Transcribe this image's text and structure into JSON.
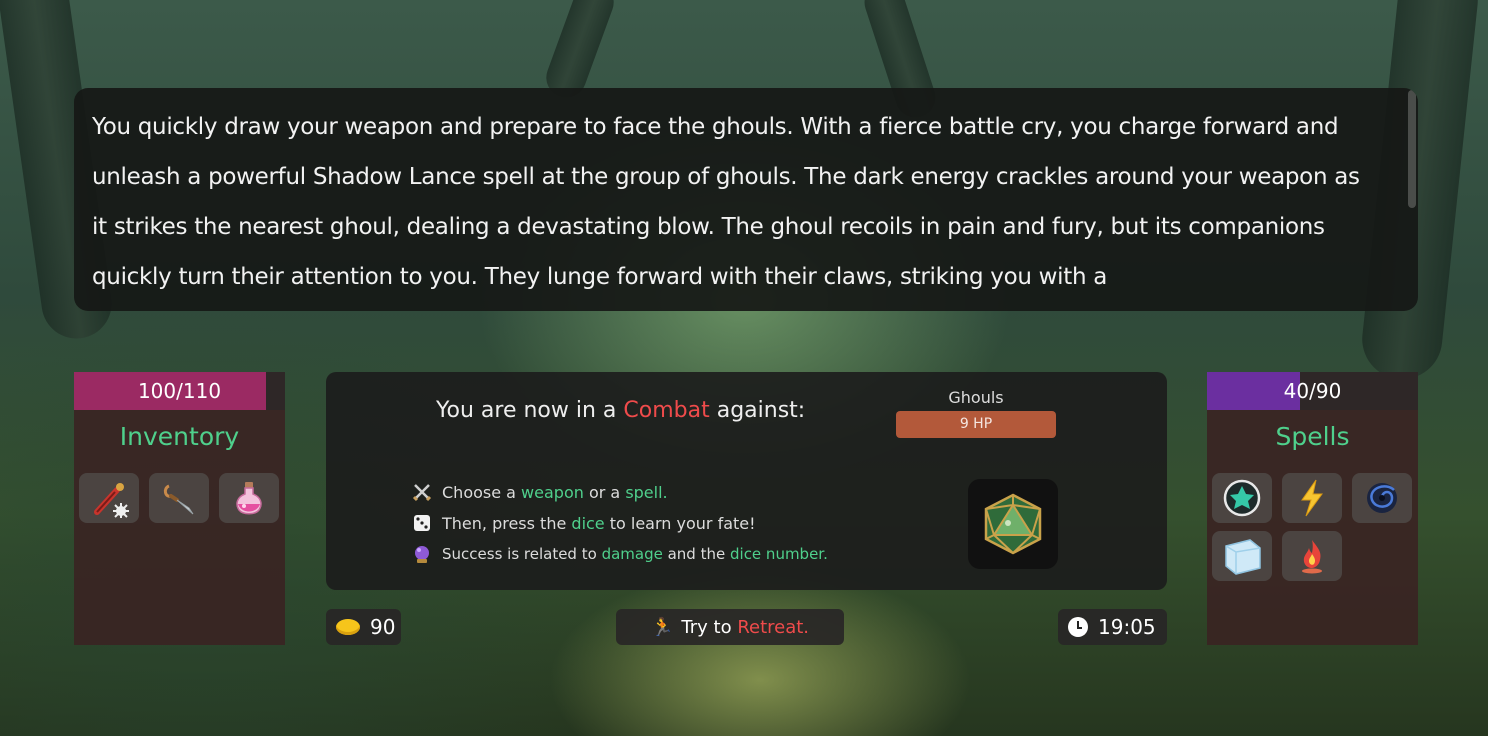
{
  "narrative": {
    "text": "You quickly draw your weapon and prepare to face the ghouls. With a fierce battle cry, you charge forward and unleash a powerful Shadow Lance spell at the group of ghouls. The dark energy crackles around your weapon as it strikes the nearest ghoul, dealing a devastating blow. The ghoul recoils in pain and fury, but its companions quickly turn their attention to you. They lunge forward with their claws, striking you with a"
  },
  "health": {
    "label": "100/110",
    "current": 100,
    "max": 110,
    "color": "#9b2a63"
  },
  "mana": {
    "label": "40/90",
    "current": 40,
    "max": 90,
    "color": "#6b2fa0"
  },
  "inventory": {
    "title": "Inventory",
    "items": [
      {
        "icon": "mace-icon"
      },
      {
        "icon": "dagger-icon"
      },
      {
        "icon": "potion-icon"
      }
    ]
  },
  "spells": {
    "title": "Spells",
    "items": [
      {
        "icon": "shadow-lance-icon"
      },
      {
        "icon": "lightning-icon"
      },
      {
        "icon": "vortex-icon"
      },
      {
        "icon": "ice-block-icon"
      },
      {
        "icon": "fire-icon"
      }
    ]
  },
  "combat": {
    "prefix": "You are now in a ",
    "keyword": "Combat",
    "suffix": " against:",
    "enemy": {
      "name": "Ghouls",
      "hp": "9 HP"
    },
    "instructions": [
      {
        "icon": "swords-icon",
        "parts": [
          "Choose a ",
          "weapon",
          " or a ",
          "spell."
        ]
      },
      {
        "icon": "dice-icon",
        "parts": [
          "Then, press the ",
          "dice",
          " to learn your fate!"
        ]
      },
      {
        "icon": "crystal-ball-icon",
        "parts": [
          "Success is related to ",
          "damage",
          " and the ",
          "dice number."
        ]
      }
    ]
  },
  "footer": {
    "gold": "90",
    "retreat_prefix": "Try to ",
    "retreat_keyword": "Retreat.",
    "time": "19:05"
  },
  "colors": {
    "accent_green": "#4fd08c",
    "accent_red": "#ef4b4b",
    "hp_bar": "#b3593a"
  }
}
